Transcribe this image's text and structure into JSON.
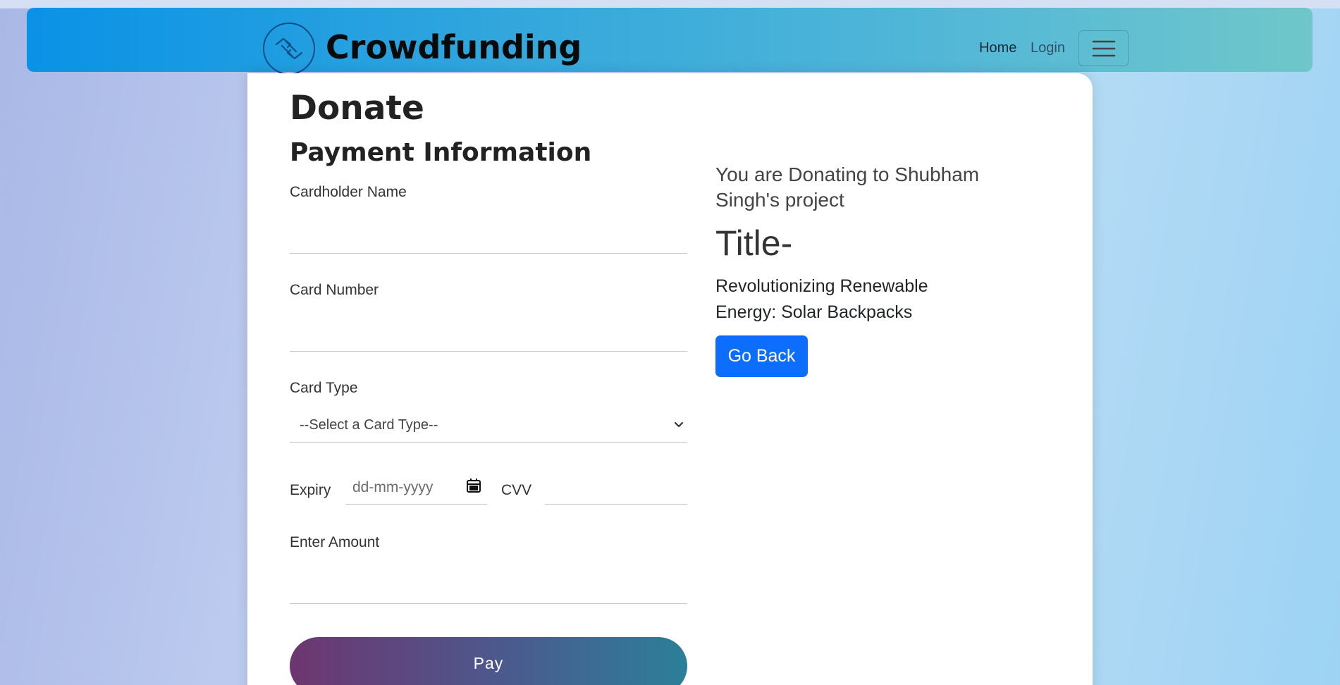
{
  "navbar": {
    "brand": "Crowdfunding",
    "logo_icon": "handshake-icon",
    "links": {
      "home": "Home",
      "login": "Login"
    },
    "menu_icon": "hamburger-icon"
  },
  "form": {
    "page_title": "Donate",
    "section_title": "Payment Information",
    "cardholder_label": "Cardholder Name",
    "cardholder_value": "",
    "card_number_label": "Card Number",
    "card_number_value": "",
    "card_type_label": "Card Type",
    "card_type_selected": "--Select a Card Type--",
    "expiry_label": "Expiry",
    "expiry_placeholder": "dd-mm-yyyy",
    "cvv_label": "CVV",
    "amount_label": "Enter Amount",
    "pay_label": "Pay"
  },
  "sidebar": {
    "intro": "You are Donating to Shubham Singh's project",
    "title_label": "Title-",
    "project_title": "Revolutionizing Renewable Energy: Solar Backpacks",
    "go_back_label": "Go Back"
  },
  "colors": {
    "primary_button": "#0d6efd",
    "pay_gradient_start": "#6d3670",
    "pay_gradient_end": "#2b7f99",
    "navbar_start": "#0a92e6",
    "navbar_end": "#6fc7c9"
  }
}
